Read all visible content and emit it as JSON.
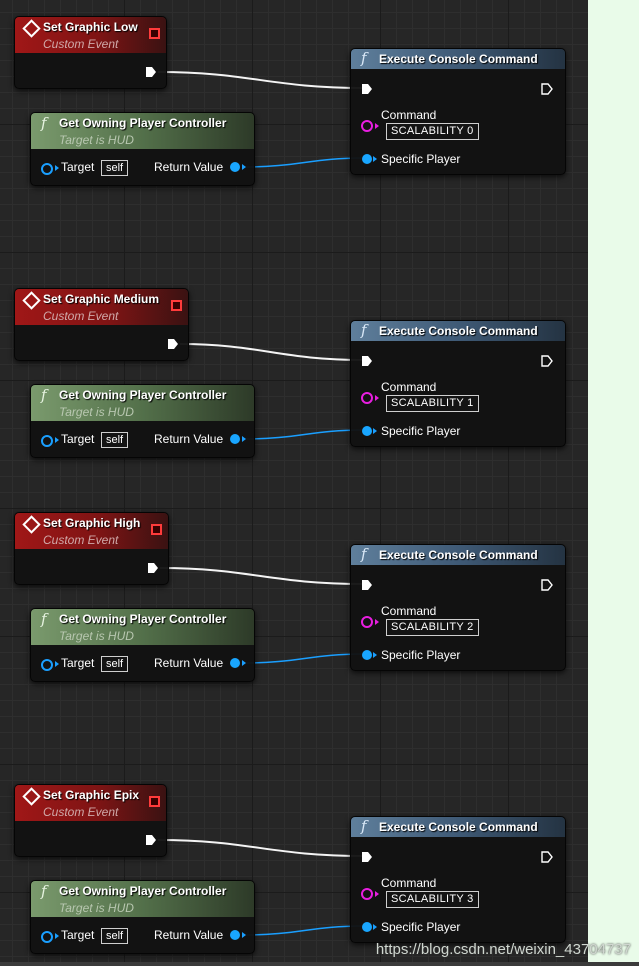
{
  "groups": [
    {
      "event": {
        "title": "Set Graphic Low",
        "subtitle": "Custom Event"
      },
      "getter": {
        "title": "Get Owning Player Controller",
        "subtitle": "Target is HUD",
        "target_label": "Target",
        "target_value": "self",
        "return_label": "Return Value"
      },
      "exec": {
        "title": "Execute Console Command",
        "command_label": "Command",
        "command_value": "SCALABILITY 0",
        "player_label": "Specific Player"
      }
    },
    {
      "event": {
        "title": "Set Graphic Medium",
        "subtitle": "Custom Event"
      },
      "getter": {
        "title": "Get Owning Player Controller",
        "subtitle": "Target is HUD",
        "target_label": "Target",
        "target_value": "self",
        "return_label": "Return Value"
      },
      "exec": {
        "title": "Execute Console Command",
        "command_label": "Command",
        "command_value": "SCALABILITY 1",
        "player_label": "Specific Player"
      }
    },
    {
      "event": {
        "title": "Set Graphic High",
        "subtitle": "Custom Event"
      },
      "getter": {
        "title": "Get Owning Player Controller",
        "subtitle": "Target is HUD",
        "target_label": "Target",
        "target_value": "self",
        "return_label": "Return Value"
      },
      "exec": {
        "title": "Execute Console Command",
        "command_label": "Command",
        "command_value": "SCALABILITY 2",
        "player_label": "Specific Player"
      }
    },
    {
      "event": {
        "title": "Set Graphic Epix",
        "subtitle": "Custom Event"
      },
      "getter": {
        "title": "Get Owning Player Controller",
        "subtitle": "Target is HUD",
        "target_label": "Target",
        "target_value": "self",
        "return_label": "Return Value"
      },
      "exec": {
        "title": "Execute Console Command",
        "command_label": "Command",
        "command_value": "SCALABILITY 3",
        "player_label": "Specific Player"
      }
    }
  ],
  "watermark": "https://blog.csdn.net/weixin_43704737",
  "colors": {
    "exec_wire": "#ffffff",
    "object_wire": "#1a9fff",
    "event_header": "#a01717",
    "pure_header": "#6b8a5e",
    "function_header": "#4c6a88",
    "string_pin": "#e81ee0"
  }
}
